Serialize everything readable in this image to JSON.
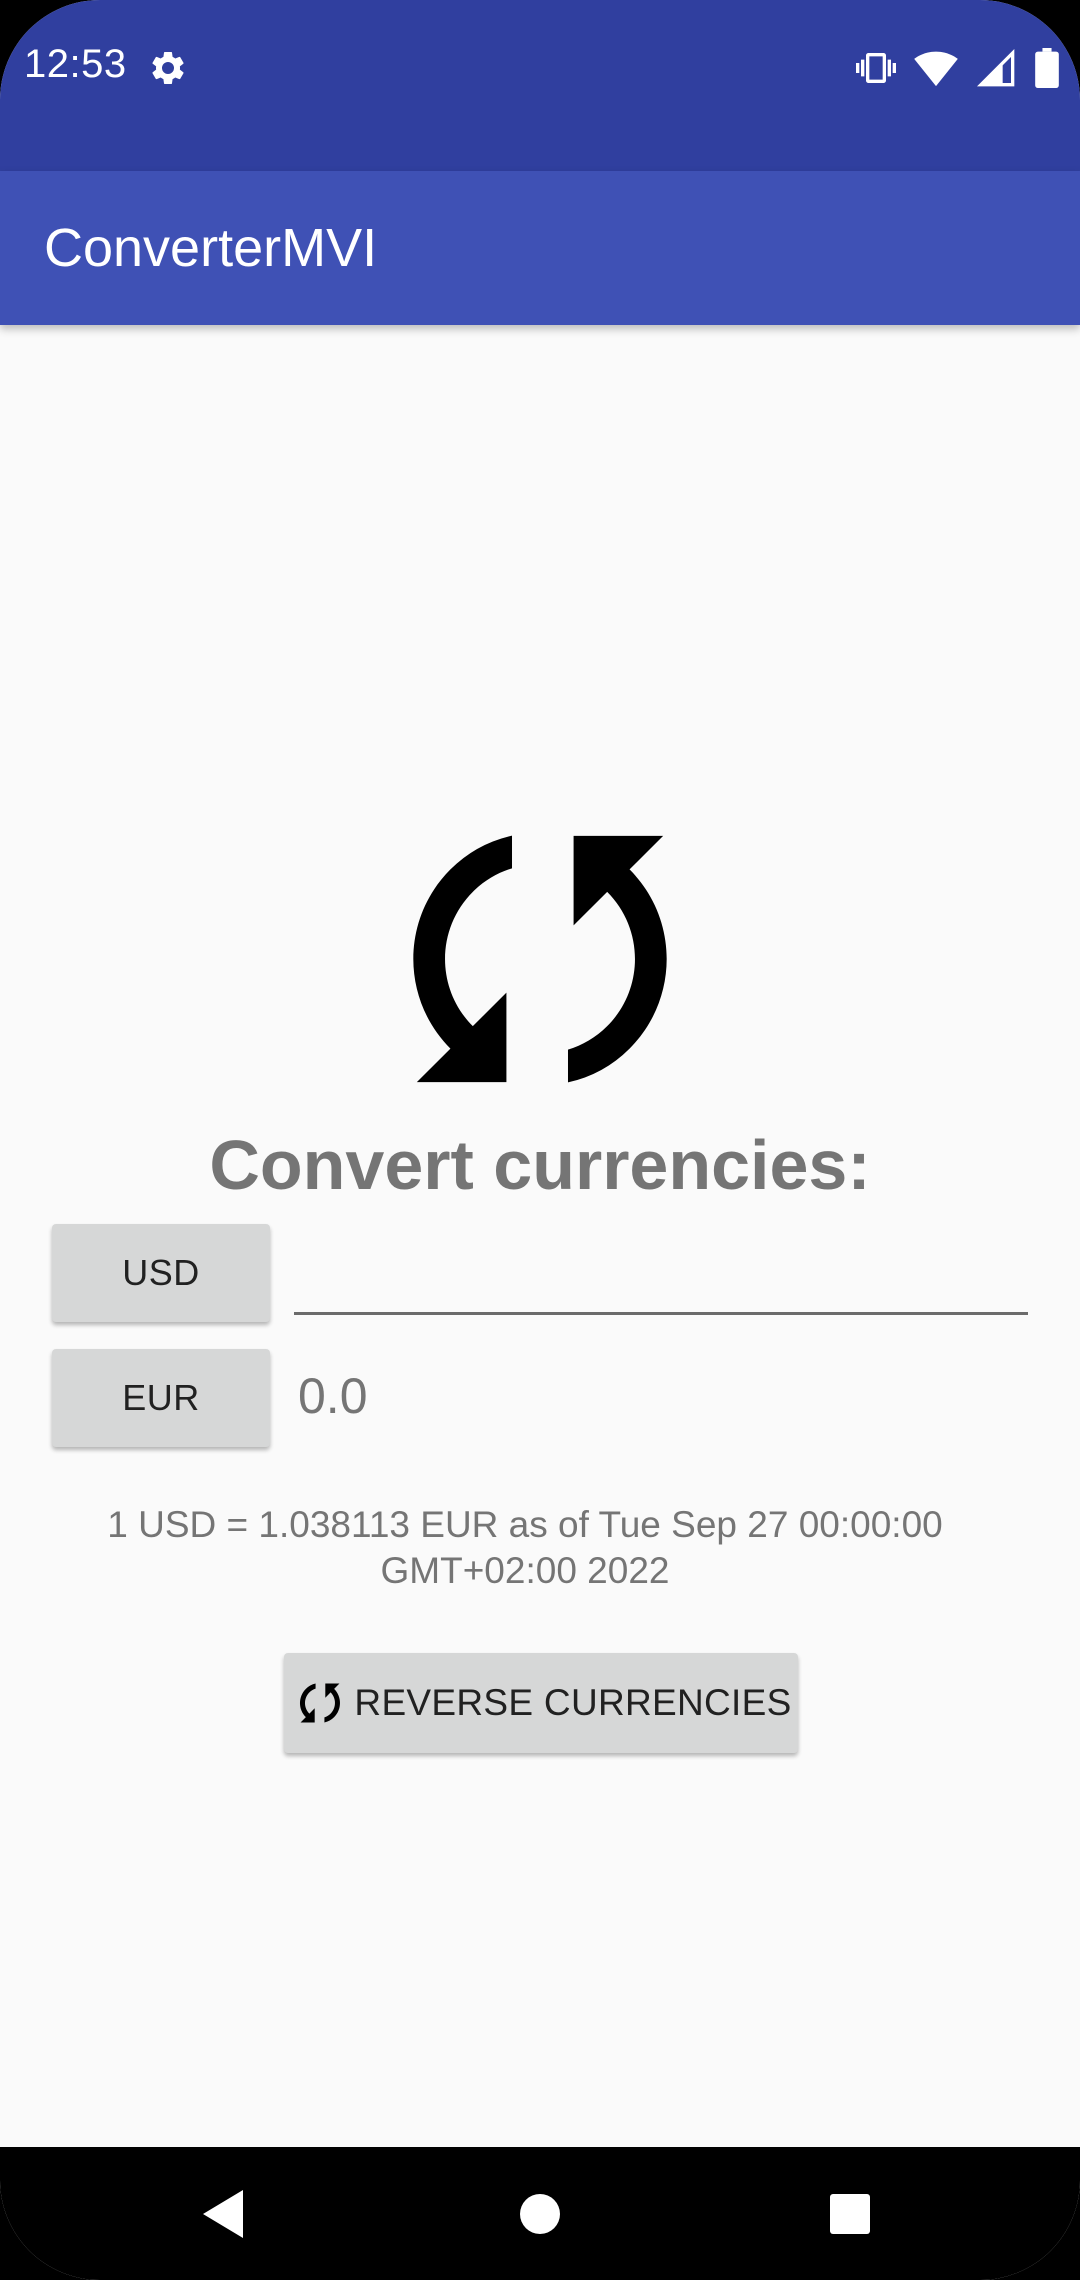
{
  "status_bar": {
    "time": "12:53",
    "icons": [
      "gear-icon",
      "vibrate-icon",
      "wifi-icon",
      "signal-icon",
      "battery-icon"
    ]
  },
  "app_bar": {
    "title": "ConverterMVI"
  },
  "main": {
    "hero_icon": "sync-icon",
    "heading": "Convert currencies:",
    "from_currency_label": "USD",
    "to_currency_label": "EUR",
    "amount_input_value": "",
    "amount_input_placeholder": "",
    "converted_value": "0.0",
    "rate_info": "1 USD = 1.038113 EUR as of Tue Sep 27 00:00:00 GMT+02:00 2022",
    "reverse_button_label": "REVERSE CURRENCIES",
    "reverse_button_icon": "sync-icon"
  },
  "nav_bar": {
    "icons": [
      "back-icon",
      "home-icon",
      "recents-icon"
    ]
  },
  "colors": {
    "status_bar": "#303f9f",
    "app_bar": "#3f51b5",
    "background": "#fafafa",
    "button": "#d6d7d7",
    "secondary_text": "#757575"
  }
}
